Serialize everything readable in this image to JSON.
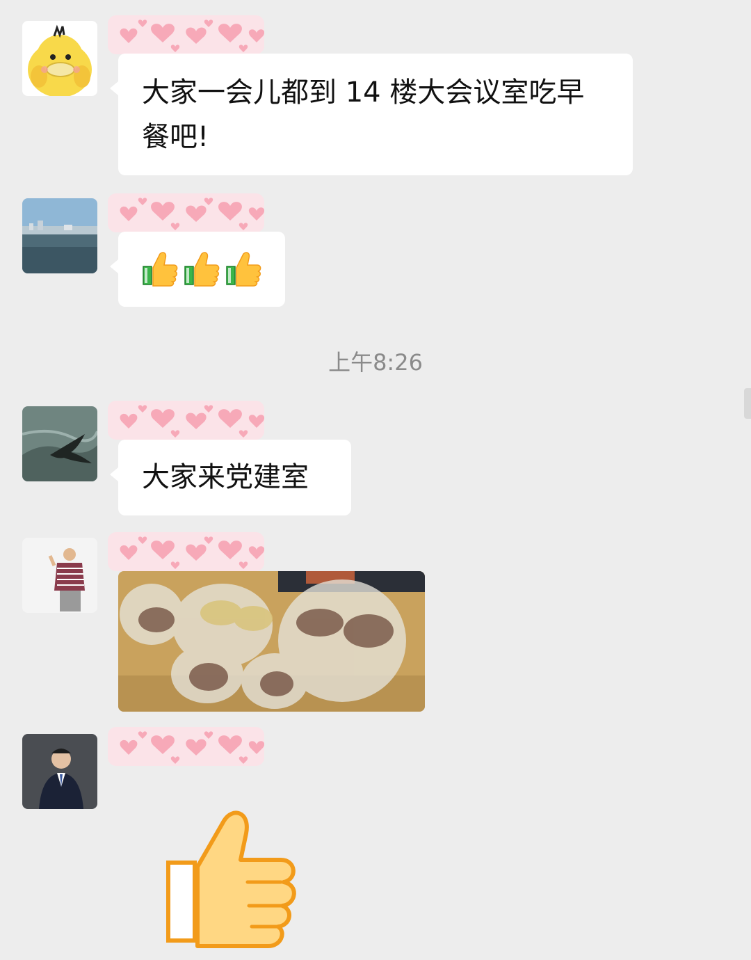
{
  "messages": [
    {
      "id": 1,
      "type": "text",
      "avatar_icon": "duck-avatar-icon",
      "text": "大家一会儿都到 14 楼大会议室吃早餐吧!"
    },
    {
      "id": 2,
      "type": "emoji",
      "avatar_icon": "sea-view-avatar-icon",
      "emoji": [
        "thumbs-up-icon",
        "thumbs-up-icon",
        "thumbs-up-icon"
      ]
    },
    {
      "id": 3,
      "type": "text",
      "avatar_icon": "bird-avatar-icon",
      "text": "大家来党建室"
    },
    {
      "id": 4,
      "type": "image",
      "avatar_icon": "man-striped-shirt-avatar-icon",
      "image_icon": "breakfast-bags-photo-icon"
    },
    {
      "id": 5,
      "type": "sticker",
      "avatar_icon": "man-in-suit-avatar-icon",
      "sticker_icon": "big-thumbs-up-icon"
    }
  ],
  "timestamp": "上午8:26",
  "colors": {
    "background": "#ededed",
    "bubble": "#ffffff",
    "timestamp": "#8a8a8a",
    "name_mask_hearts": "#f7a9b8"
  }
}
